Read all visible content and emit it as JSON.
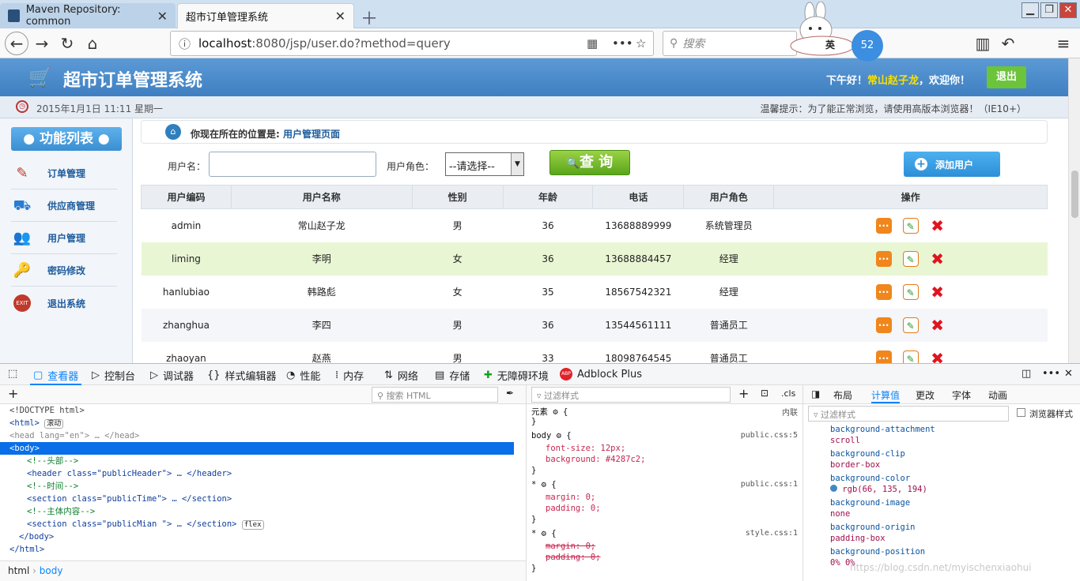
{
  "browser": {
    "tabs": [
      {
        "label": "Maven Repository: common"
      },
      {
        "label": "超市订单管理系统"
      }
    ],
    "url_host": "localhost",
    "url_rest": ":8080/jsp/user.do?method=query",
    "search_placeholder": "搜索",
    "ime_label": "英",
    "clock_text": "52"
  },
  "app": {
    "title": "超市订单管理系统",
    "greeting_prefix": "下午好！",
    "username": "常山赵子龙",
    "greeting_suffix": "，欢迎你！",
    "logout_label": "退出",
    "datetime": "2015年1月1日 11:11 星期一",
    "tip": "温馨提示：为了能正常浏览，请使用高版本浏览器！（IE10+）"
  },
  "sidebar": {
    "heading": "功能列表",
    "items": [
      {
        "label": "订单管理",
        "icon": "order-icon"
      },
      {
        "label": "供应商管理",
        "icon": "supplier-icon"
      },
      {
        "label": "用户管理",
        "icon": "users-icon"
      },
      {
        "label": "密码修改",
        "icon": "password-icon"
      },
      {
        "label": "退出系统",
        "icon": "exit-icon"
      }
    ]
  },
  "location": {
    "prefix": "你现在所在的位置是:",
    "page": "用户管理页面"
  },
  "search_form": {
    "username_label": "用户名：",
    "username_value": "",
    "role_label": "用户角色：",
    "role_selected": "--请选择--",
    "query_label": "查 询",
    "add_label": "添加用户"
  },
  "table": {
    "headers": [
      "用户编码",
      "用户名称",
      "性别",
      "年龄",
      "电话",
      "用户角色",
      "操作"
    ],
    "rows": [
      [
        "admin",
        "常山赵子龙",
        "男",
        "36",
        "13688889999",
        "系统管理员"
      ],
      [
        "liming",
        "李明",
        "女",
        "36",
        "13688884457",
        "经理"
      ],
      [
        "hanlubiao",
        "韩路彪",
        "女",
        "35",
        "18567542321",
        "经理"
      ],
      [
        "zhanghua",
        "李四",
        "男",
        "36",
        "13544561111",
        "普通员工"
      ],
      [
        "zhaoyan",
        "赵燕",
        "男",
        "33",
        "18098764545",
        "普通员工"
      ]
    ]
  },
  "devtools": {
    "tabs": [
      "查看器",
      "控制台",
      "调试器",
      "样式编辑器",
      "性能",
      "内存",
      "网络",
      "存储",
      "无障碍环境",
      "Adblock Plus"
    ],
    "html_search_placeholder": "搜索 HTML",
    "styles_filter_placeholder": "过滤样式",
    "cls_label": ".cls",
    "layout_tabs": [
      "布局",
      "计算值",
      "更改",
      "字体",
      "动画"
    ],
    "computed_filter_placeholder": "过滤样式",
    "browser_styles_label": "浏览器样式",
    "html_lines": [
      "<!DOCTYPE html>",
      "<html>",
      "<head lang=\"en\"> … </head>",
      "<body>",
      "<!--头部-->",
      "<header class=\"publicHeader\"> … </header>",
      "<!--时间-->",
      "<section class=\"publicTime\"> … </section>",
      "<!--主体内容-->",
      "<section class=\"publicMian \"> … </section>",
      "</body>",
      "</html>"
    ],
    "scroll_badge": "滚动",
    "flex_badge": "flex",
    "breadcrumb": [
      "html",
      "body"
    ],
    "rules": [
      {
        "selector": "元素",
        "source": "内联",
        "decls": []
      },
      {
        "selector": "body",
        "source": "public.css:5",
        "decls": [
          "font-size: 12px;",
          "background: #4287c2;"
        ]
      },
      {
        "selector": "*",
        "source": "public.css:1",
        "decls": [
          "margin: 0;",
          "padding: 0;"
        ]
      },
      {
        "selector": "*",
        "source": "style.css:1",
        "decls": [
          "margin: 0;",
          "padding: 0;"
        ]
      }
    ],
    "computed": [
      {
        "prop": "background-attachment",
        "value": "scroll"
      },
      {
        "prop": "background-clip",
        "value": "border-box"
      },
      {
        "prop": "background-color",
        "value": "rgb(66, 135, 194)"
      },
      {
        "prop": "background-image",
        "value": "none"
      },
      {
        "prop": "background-origin",
        "value": "padding-box"
      },
      {
        "prop": "background-position",
        "value": "0% 0%"
      }
    ],
    "watermark": "https://blog.csdn.net/myischenxiaohui"
  },
  "colors": {
    "header_blue": "#4287c2",
    "logout_green": "#6cc43b",
    "highlight_row": "#e9f6d4",
    "devtools_accent": "#0a84ff"
  }
}
